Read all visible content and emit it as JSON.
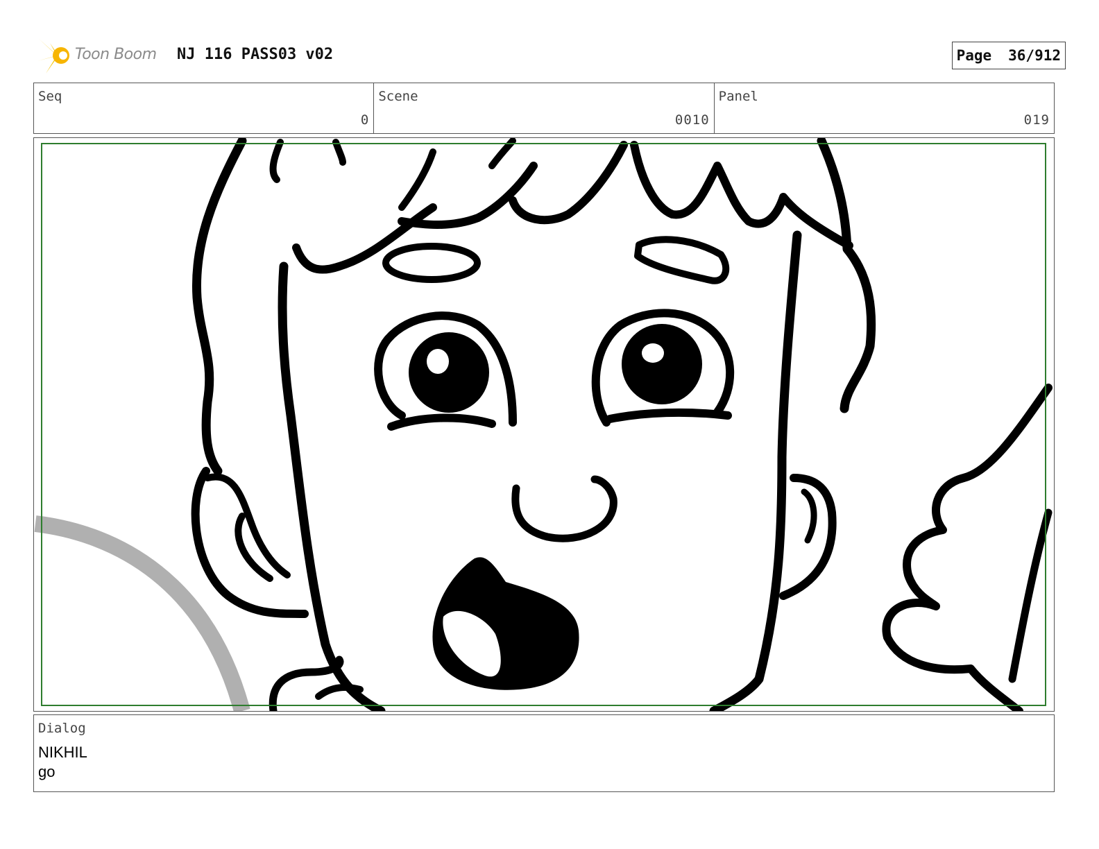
{
  "header": {
    "logo_text": "Toon Boom",
    "title": "NJ 116 PASS03 v02",
    "page_label": "Page",
    "page_value": "36/912"
  },
  "meta": {
    "seq_label": "Seq",
    "seq_value": "0",
    "scene_label": "Scene",
    "scene_value": "0010",
    "panel_label": "Panel",
    "panel_value": "019"
  },
  "dialog": {
    "label": "Dialog",
    "speaker": "NIKHIL",
    "line": "go"
  },
  "colors": {
    "safe_frame": "#2e7d2e",
    "ink": "#000000",
    "guide_arc": "#b0b0b0",
    "logo_star": "#f5c400"
  }
}
